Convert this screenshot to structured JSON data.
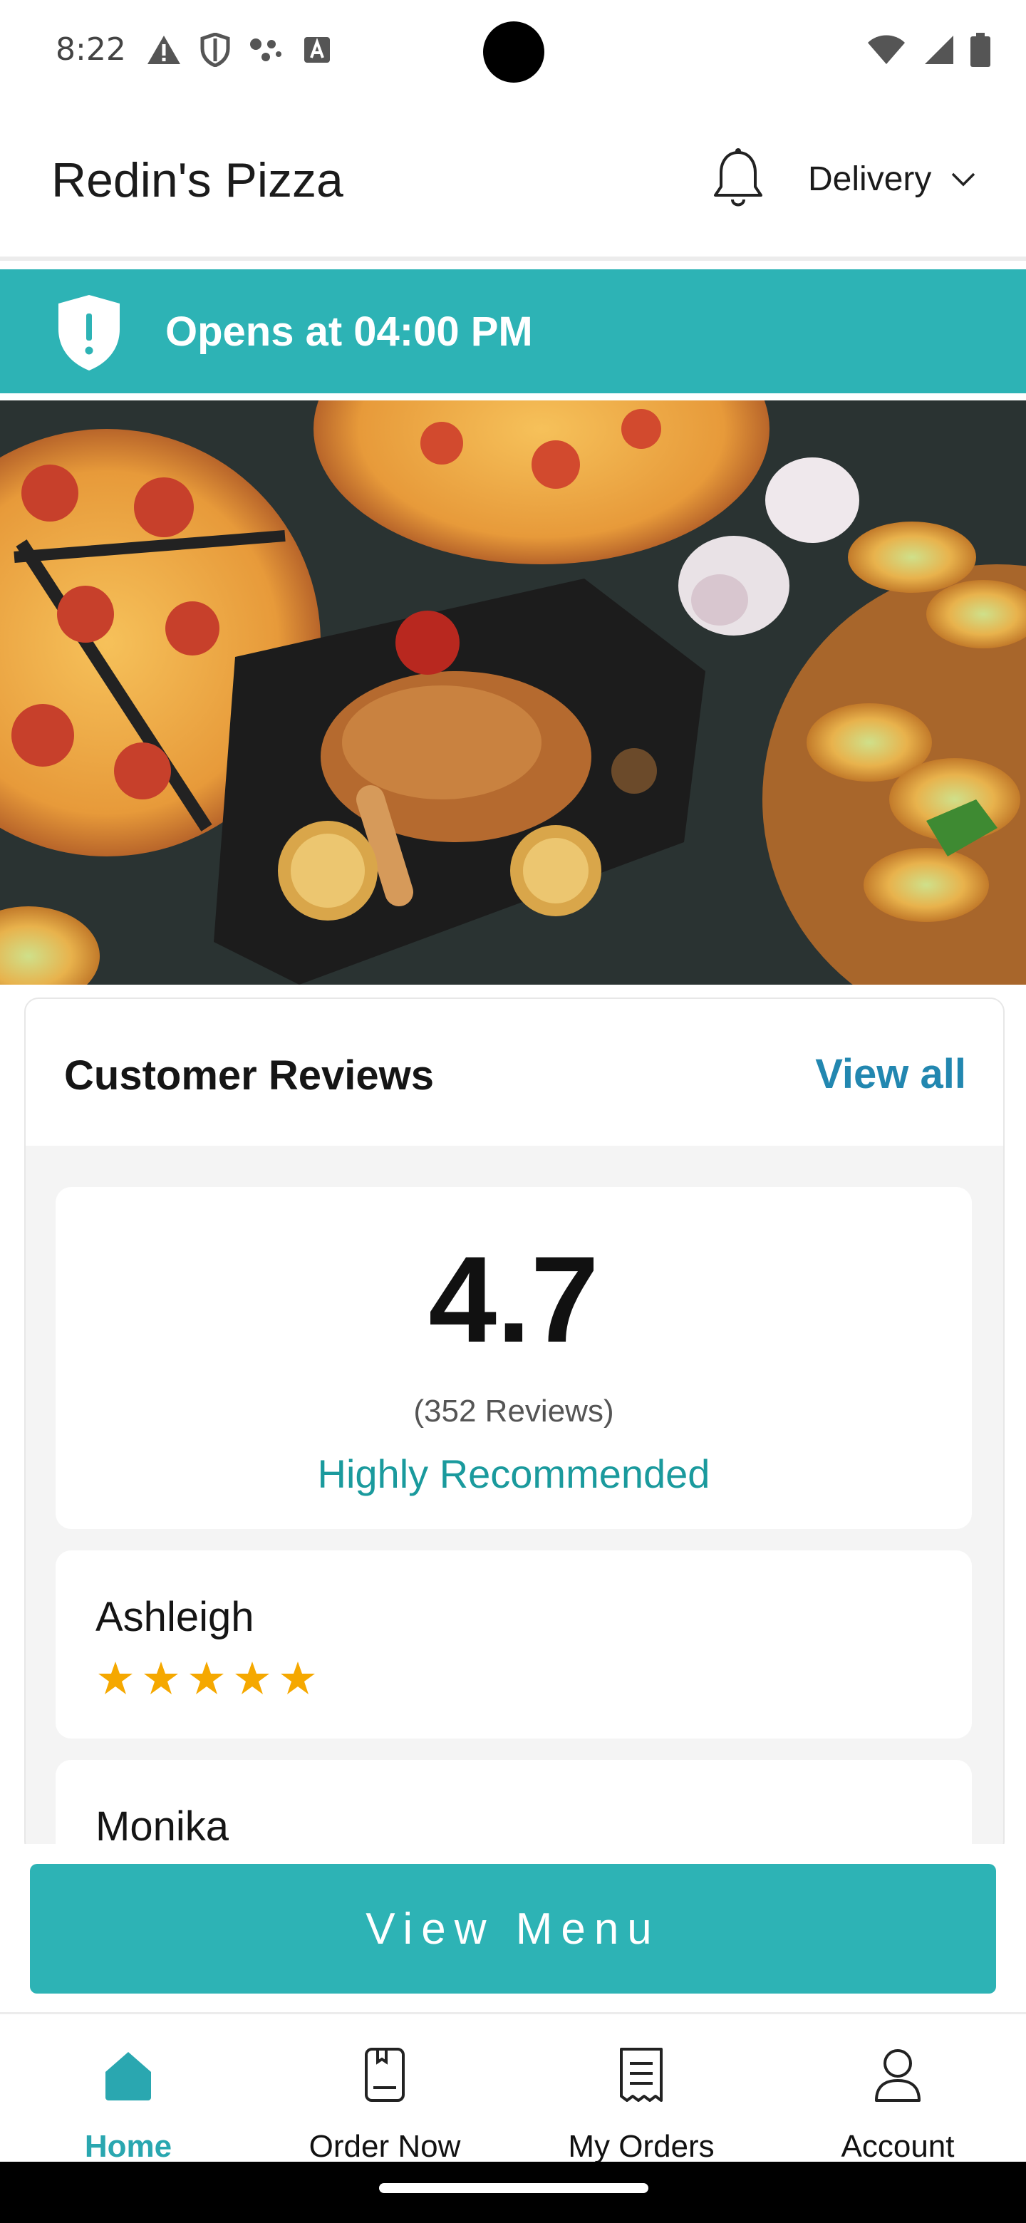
{
  "status_bar": {
    "time": "8:22",
    "left_icons": [
      "warning-icon",
      "shield-icon",
      "assistant-dots-icon",
      "a-box-icon"
    ],
    "right_icons": [
      "wifi-icon",
      "signal-icon",
      "battery-icon"
    ]
  },
  "header": {
    "brand": "Redin's Pizza",
    "mode_label": "Delivery"
  },
  "banner": {
    "text": "Opens at 04:00 PM",
    "color": "#2db3b5"
  },
  "hero": {
    "icon": "food-photo"
  },
  "reviews": {
    "title": "Customer Reviews",
    "view_all": "View all",
    "score": "4.7",
    "count": "(352 Reviews)",
    "recommendation": "Highly Recommended",
    "items": [
      {
        "name": "Ashleigh",
        "stars": 5
      },
      {
        "name": "Monika"
      }
    ]
  },
  "cta": {
    "label": "View Menu",
    "color": "#2db3b5"
  },
  "nav": {
    "items": [
      {
        "label": "Home",
        "icon": "home-icon",
        "active": true
      },
      {
        "label": "Order Now",
        "icon": "order-icon"
      },
      {
        "label": "My Orders",
        "icon": "receipt-icon"
      },
      {
        "label": "Account",
        "icon": "person-icon"
      }
    ]
  },
  "colors": {
    "accent": "#2db3b5",
    "link": "#2287b0",
    "recommend": "#1a9a9d",
    "star": "#f5a800"
  }
}
